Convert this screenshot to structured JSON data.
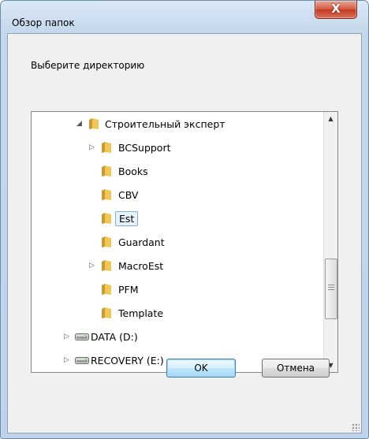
{
  "window": {
    "title": "Обзор папок",
    "close_glyph": "X"
  },
  "prompt": "Выберите директорию",
  "tree": {
    "items": [
      {
        "label": "Строительный эксперт",
        "level": "parent",
        "expander": "expanded",
        "icon": "folder-icon"
      },
      {
        "label": "BCSupport",
        "level": "child",
        "expander": "collapsed",
        "icon": "folder-icon"
      },
      {
        "label": "Books",
        "level": "child",
        "expander": "none",
        "icon": "folder-icon"
      },
      {
        "label": "CBV",
        "level": "child",
        "expander": "none",
        "icon": "folder-icon"
      },
      {
        "label": "Est",
        "level": "child",
        "expander": "none",
        "icon": "folder-icon",
        "selected": true
      },
      {
        "label": "Guardant",
        "level": "child",
        "expander": "none",
        "icon": "folder-icon"
      },
      {
        "label": "MacroEst",
        "level": "child",
        "expander": "collapsed",
        "icon": "folder-icon"
      },
      {
        "label": "PFM",
        "level": "child",
        "expander": "none",
        "icon": "folder-icon"
      },
      {
        "label": "Template",
        "level": "child",
        "expander": "none",
        "icon": "folder-icon"
      },
      {
        "label": "DATA (D:)",
        "level": "drive",
        "expander": "collapsed",
        "icon": "drive-icon"
      },
      {
        "label": "RECOVERY (E:)",
        "level": "drive",
        "expander": "collapsed",
        "icon": "drive-icon"
      }
    ]
  },
  "buttons": {
    "ok": "OK",
    "cancel": "Отмена"
  },
  "colors": {
    "selection_fill": "#e5f3fb",
    "selection_border": "#84acdd",
    "folder": "#e8b84a",
    "close": "#c8442b"
  }
}
